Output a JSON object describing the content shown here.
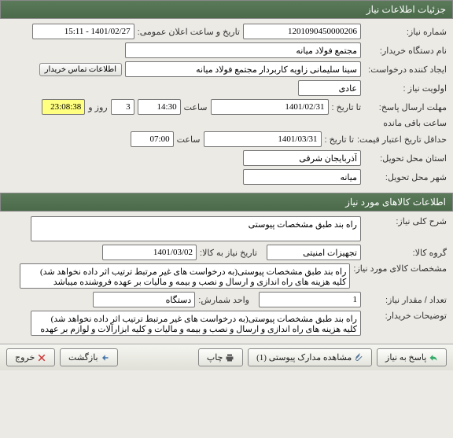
{
  "header1": "جزئیات اطلاعات نیاز",
  "f1": {
    "need_no_lbl": "شماره نیاز:",
    "need_no": "1201090450000206",
    "announce_lbl": "تاریخ و ساعت اعلان عمومی:",
    "announce_val": "1401/02/27 - 15:11",
    "buyer_lbl": "نام دستگاه خریدار:",
    "buyer": "مجتمع فولاد میانه",
    "creator_lbl": "ایجاد کننده درخواست:",
    "creator": "سینا سلیمانی زاویه کاربردار مجتمع فولاد میانه",
    "contact_btn": "اطلاعات تماس خریدار",
    "priority_lbl": "اولویت نیاز :",
    "priority": "عادی",
    "deadline_reply_lbl": "مهلت ارسال پاسخ:",
    "to_date_lbl": "تا تاریخ :",
    "date1": "1401/02/31",
    "time_lbl": "ساعت",
    "time1": "14:30",
    "days": "3",
    "days_lbl": "روز و",
    "remain_time": "23:08:38",
    "remain_lbl": "ساعت باقی مانده",
    "price_valid_lbl": "حداقل تاریخ اعتبار قیمت:",
    "date2": "1401/03/31",
    "time2": "07:00",
    "province_lbl": "استان محل تحویل:",
    "province": "آذربایجان شرقی",
    "city_lbl": "شهر محل تحویل:",
    "city": "میانه"
  },
  "header2": "اطلاعات کالاهای مورد نیاز",
  "f2": {
    "overview_lbl": "شرح کلی نیاز:",
    "overview": "راه بند طبق مشخصات پیوستی",
    "group_lbl": "گروه کالا:",
    "group": "تجهیزات امنیتی",
    "need_date_lbl": "تاریخ نیاز به کالا:",
    "need_date": "1401/03/02",
    "item_spec_lbl": "مشخصات کالای مورد نیاز:",
    "item_spec": "راه بند طبق مشخصات پیوستی(به درخواست های غیر مرتبط ترتیب اثر داده نخواهد شد) کلیه هزینه های راه اندازی و ارسال و نصب و بیمه و مالیات بر عهده فروشنده میباشد",
    "qty_lbl": "تعداد / مقدار نیاز:",
    "qty": "1",
    "unit_lbl": "واحد شمارش:",
    "unit": "دستگاه",
    "buyer_notes_lbl": "توضیحات خریدار:",
    "buyer_notes": "راه بند طبق مشخصات پیوستی(به درخواست های غیر مرتبط ترتیب اثر داده نخواهد شد) کلیه هزینه های راه اندازی و ارسال و نصب و بیمه و مالیات و کلیه ابزارآلات و لوازم بر عهده فروشنده میباشد"
  },
  "footer": {
    "reply": "پاسخ به نیاز",
    "attach": "مشاهده مدارک پیوستی (1)",
    "print": "چاپ",
    "back": "بازگشت",
    "exit": "خروج"
  }
}
